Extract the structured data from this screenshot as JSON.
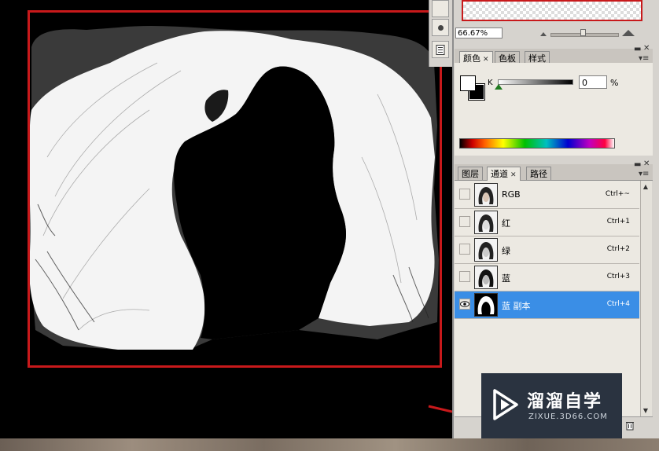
{
  "navigator": {
    "zoom": "66.67%"
  },
  "color_panel": {
    "tabs": [
      {
        "label": "颜色",
        "closable": true,
        "active": true
      },
      {
        "label": "色板",
        "closable": false,
        "active": false
      },
      {
        "label": "样式",
        "closable": false,
        "active": false
      }
    ],
    "channel_label": "K",
    "value": "0",
    "unit": "%"
  },
  "channels_panel": {
    "tabs": [
      {
        "label": "图层",
        "closable": false,
        "active": false
      },
      {
        "label": "通道",
        "closable": true,
        "active": true
      },
      {
        "label": "路径",
        "closable": false,
        "active": false
      }
    ],
    "rows": [
      {
        "name": "RGB",
        "shortcut": "Ctrl+~",
        "visible": false,
        "selected": false
      },
      {
        "name": "红",
        "shortcut": "Ctrl+1",
        "visible": false,
        "selected": false
      },
      {
        "name": "绿",
        "shortcut": "Ctrl+2",
        "visible": false,
        "selected": false
      },
      {
        "name": "蓝",
        "shortcut": "Ctrl+3",
        "visible": false,
        "selected": false
      },
      {
        "name": "蓝 副本",
        "shortcut": "Ctrl+4",
        "visible": true,
        "selected": true
      }
    ]
  },
  "watermark": {
    "title": "溜溜自学",
    "url": "ZIXUE.3D66.COM"
  },
  "icons": [
    "eye-icon",
    "close-icon",
    "panel-menu-icon",
    "trash-icon",
    "play-logo-icon"
  ],
  "colors": {
    "selection_red": "#c8191b",
    "selected_row": "#3a8ee6",
    "panel_bg": "#d6d3ce"
  }
}
